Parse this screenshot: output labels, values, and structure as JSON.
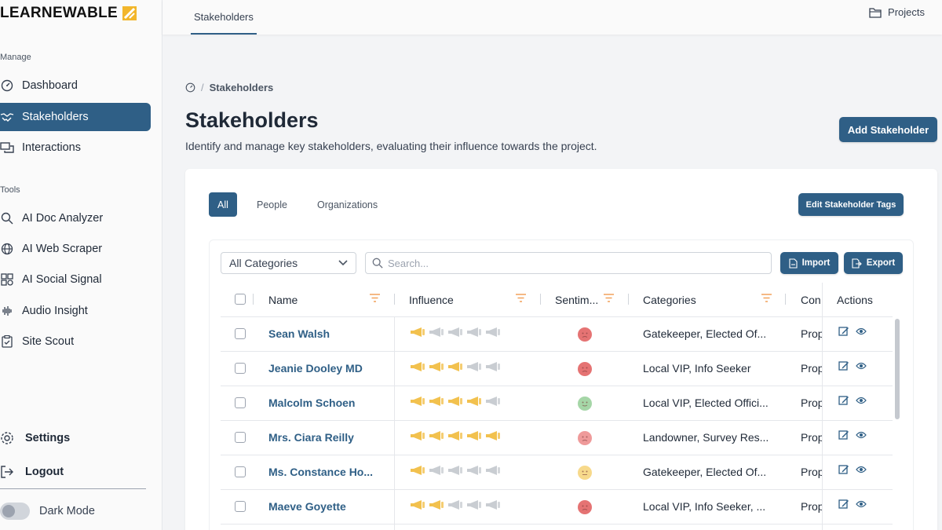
{
  "app": {
    "logo_text": "LEARNEWABLE"
  },
  "sidebar": {
    "manage_label": "Manage",
    "tools_label": "Tools",
    "manage_items": [
      {
        "label": "Dashboard",
        "icon": "dashboard-icon"
      },
      {
        "label": "Stakeholders",
        "icon": "handshake-icon",
        "active": true
      },
      {
        "label": "Interactions",
        "icon": "chat-icon"
      }
    ],
    "tools_items": [
      {
        "label": "AI Doc Analyzer",
        "icon": "search-icon"
      },
      {
        "label": "AI Web Scraper",
        "icon": "globe-icon"
      },
      {
        "label": "AI Social Signal",
        "icon": "social-icon"
      },
      {
        "label": "Audio Insight",
        "icon": "waveform-icon"
      },
      {
        "label": "Site Scout",
        "icon": "clipboard-icon"
      }
    ],
    "settings_label": "Settings",
    "logout_label": "Logout",
    "dark_mode_label": "Dark Mode",
    "dark_mode_on": false
  },
  "topbar": {
    "tab_label": "Stakeholders",
    "projects_label": "Projects"
  },
  "breadcrumb": {
    "current": "Stakeholders"
  },
  "page": {
    "title": "Stakeholders",
    "subtitle": "Identify and manage key stakeholders, evaluating their influence towards the project.",
    "add_button": "Add Stakeholder"
  },
  "filters": {
    "tabs": [
      "All",
      "People",
      "Organizations"
    ],
    "active_tab": "All",
    "edit_tags_button": "Edit Stakeholder Tags",
    "category_select": "All Categories",
    "search_placeholder": "Search...",
    "import_button": "Import",
    "export_button": "Export"
  },
  "table": {
    "columns": [
      "Name",
      "Influence",
      "Sentim...",
      "Categories",
      "Con",
      "Actions"
    ],
    "rows": [
      {
        "name": "Sean Walsh",
        "influence": 1,
        "sentiment": "negative",
        "categories": "Gatekeeper, Elected Of...",
        "con": "Prop"
      },
      {
        "name": "Jeanie Dooley MD",
        "influence": 3,
        "sentiment": "negative",
        "categories": "Local VIP, Info Seeker",
        "con": "Prop"
      },
      {
        "name": "Malcolm Schoen",
        "influence": 4,
        "sentiment": "positive",
        "categories": "Local VIP, Elected Offici...",
        "con": "Prop"
      },
      {
        "name": "Mrs. Ciara Reilly",
        "influence": 5,
        "sentiment": "negative-light",
        "categories": "Landowner, Survey Res...",
        "con": "Prop"
      },
      {
        "name": "Ms. Constance Ho...",
        "influence": 1,
        "sentiment": "neutral",
        "categories": "Gatekeeper, Elected Of...",
        "con": "Prop"
      },
      {
        "name": "Maeve Goyette",
        "influence": 2,
        "sentiment": "negative",
        "categories": "Local VIP, Info Seeker, ...",
        "con": "Prop"
      }
    ],
    "influence_max": 5
  },
  "colors": {
    "primary": "#2f5f86",
    "mega_on": "#f2c14e",
    "mega_off": "#c9cdd2",
    "sentiment_negative": "#e57373",
    "sentiment_negative_light": "#ef9a9a",
    "sentiment_positive": "#a5d6a7",
    "sentiment_neutral": "#f7d98b"
  }
}
